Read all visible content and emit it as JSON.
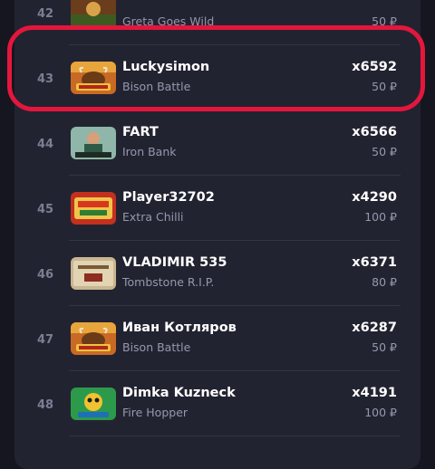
{
  "currency": "₽",
  "rows": [
    {
      "rank": "42",
      "name": "",
      "game": "Greta Goes Wild",
      "multiplier": "",
      "bet": "50 ₽",
      "thumb": "greta-goes-wild-thumbnail"
    },
    {
      "rank": "43",
      "name": "Luckysimon",
      "game": "Bison Battle",
      "multiplier": "x6592",
      "bet": "50 ₽",
      "thumb": "bison-battle-thumbnail",
      "highlighted": true
    },
    {
      "rank": "44",
      "name": "FART",
      "game": "Iron Bank",
      "multiplier": "x6566",
      "bet": "50 ₽",
      "thumb": "iron-bank-thumbnail"
    },
    {
      "rank": "45",
      "name": "Player32702",
      "game": "Extra Chilli",
      "multiplier": "x4290",
      "bet": "100 ₽",
      "thumb": "extra-chilli-thumbnail"
    },
    {
      "rank": "46",
      "name": "VLADIMIR 535",
      "game": "Tombstone R.I.P.",
      "multiplier": "x6371",
      "bet": "80 ₽",
      "thumb": "tombstone-rip-thumbnail"
    },
    {
      "rank": "47",
      "name": "Иван Котляров",
      "game": "Bison Battle",
      "multiplier": "x6287",
      "bet": "50 ₽",
      "thumb": "bison-battle-thumbnail"
    },
    {
      "rank": "48",
      "name": "Dimka Kuzneck",
      "game": "Fire Hopper",
      "multiplier": "x4191",
      "bet": "100 ₽",
      "thumb": "fire-hopper-thumbnail"
    }
  ],
  "colors": {
    "background": "#15161f",
    "panel": "#222331",
    "highlight": "#e5163c",
    "secondary_text": "#9598ad"
  }
}
